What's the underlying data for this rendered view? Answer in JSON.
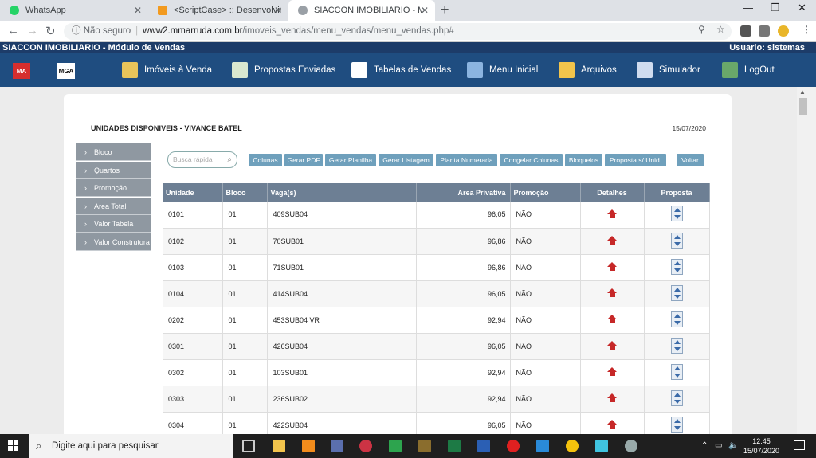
{
  "browser": {
    "tabs": [
      {
        "label": "WhatsApp"
      },
      {
        "label": "<ScriptCase> :: Desenvolvimento"
      },
      {
        "label": "SIACCON IMOBILIARIO - Módulo"
      }
    ],
    "new_tab": "+",
    "address": {
      "security": "Não seguro",
      "host": "www2.mmarruda.com.br",
      "path": "/imoveis_vendas/menu_vendas/menu_vendas.php#"
    }
  },
  "app": {
    "title": "SIACCON IMOBILIARIO - Módulo de Vendas",
    "user": "Usuario: sistemas",
    "logos": [
      "MA",
      "MGA"
    ],
    "menu": [
      {
        "label": "Imóveis à Venda",
        "icon": "keys-icon",
        "color": "#e8c45a"
      },
      {
        "label": "Propostas Enviadas",
        "icon": "document-icon",
        "color": "#d9e8d0"
      },
      {
        "label": "Tabelas de Vendas",
        "icon": "files-icon",
        "color": "#ffffff"
      },
      {
        "label": "Menu Inicial",
        "icon": "computer-icon",
        "color": "#8bb4e0"
      },
      {
        "label": "Arquivos",
        "icon": "folder-icon",
        "color": "#f2c44c"
      },
      {
        "label": "Simulador",
        "icon": "calculator-icon",
        "color": "#d0dcef"
      },
      {
        "label": "LogOut",
        "icon": "exit-door-icon",
        "color": "#6aa86a"
      }
    ]
  },
  "page": {
    "title": "UNIDADES DISPONIVEIS - VIVANCE BATEL",
    "date": "15/07/2020",
    "filters": [
      "Bloco",
      "Quartos",
      "Promoção",
      "Area Total",
      "Valor Tabela",
      "Valor Construtora"
    ],
    "search_placeholder": "Busca rápida",
    "toolbar": [
      "Colunas",
      "Gerar PDF",
      "Gerar Planilha",
      "Gerar Listagem",
      "Planta Numerada",
      "Congelar Colunas",
      "Bloqueios",
      "Proposta s/ Unid.",
      "Voltar"
    ],
    "columns": [
      "Unidade",
      "Bloco",
      "Vaga(s)",
      "Area Privativa",
      "Promoção",
      "Detalhes",
      "Proposta"
    ],
    "rows": [
      {
        "unidade": "0101",
        "bloco": "01",
        "vagas": "409SUB04",
        "area": "96,05",
        "promocao": "NÃO"
      },
      {
        "unidade": "0102",
        "bloco": "01",
        "vagas": "70SUB01",
        "area": "96,86",
        "promocao": "NÃO"
      },
      {
        "unidade": "0103",
        "bloco": "01",
        "vagas": "71SUB01",
        "area": "96,86",
        "promocao": "NÃO"
      },
      {
        "unidade": "0104",
        "bloco": "01",
        "vagas": "414SUB04",
        "area": "96,05",
        "promocao": "NÃO"
      },
      {
        "unidade": "0202",
        "bloco": "01",
        "vagas": "453SUB04 VR",
        "area": "92,94",
        "promocao": "NÃO"
      },
      {
        "unidade": "0301",
        "bloco": "01",
        "vagas": "426SUB04",
        "area": "96,05",
        "promocao": "NÃO"
      },
      {
        "unidade": "0302",
        "bloco": "01",
        "vagas": "103SUB01",
        "area": "92,94",
        "promocao": "NÃO"
      },
      {
        "unidade": "0303",
        "bloco": "01",
        "vagas": "236SUB02",
        "area": "92,94",
        "promocao": "NÃO"
      },
      {
        "unidade": "0304",
        "bloco": "01",
        "vagas": "422SUB04",
        "area": "96,05",
        "promocao": "NÃO"
      }
    ]
  },
  "taskbar": {
    "search_placeholder": "Digite aqui para pesquisar",
    "time": "12:45",
    "date": "15/07/2020"
  }
}
